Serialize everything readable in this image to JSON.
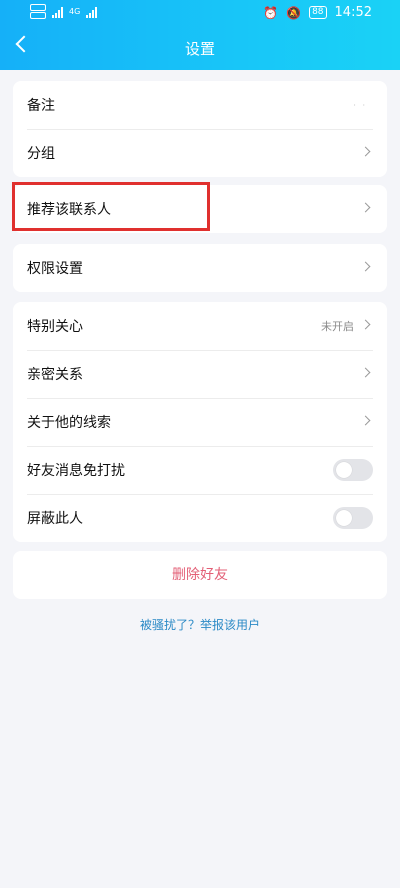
{
  "status_bar": {
    "sim1": "HD 1",
    "sim2": "HD 2",
    "network": "4G",
    "battery": "88",
    "time": "14:52"
  },
  "header": {
    "title": "设置"
  },
  "sections": [
    {
      "items": [
        {
          "label": "备注",
          "value": ""
        },
        {
          "label": "分组"
        }
      ]
    },
    {
      "items": [
        {
          "label": "推荐该联系人"
        }
      ]
    },
    {
      "items": [
        {
          "label": "权限设置"
        }
      ]
    },
    {
      "items": [
        {
          "label": "特别关心",
          "value": "未开启"
        },
        {
          "label": "亲密关系"
        },
        {
          "label": "关于他的线索"
        },
        {
          "label": "好友消息免打扰",
          "toggle": false
        },
        {
          "label": "屏蔽此人",
          "toggle": false
        }
      ]
    }
  ],
  "delete_button": "删除好友",
  "report_link": "被骚扰了？举报该用户",
  "colors": {
    "header_start": "#15b0f8",
    "header_end": "#1ad2f6",
    "delete": "#e35f76",
    "link": "#2b8ac6",
    "highlight": "#e0302e"
  }
}
